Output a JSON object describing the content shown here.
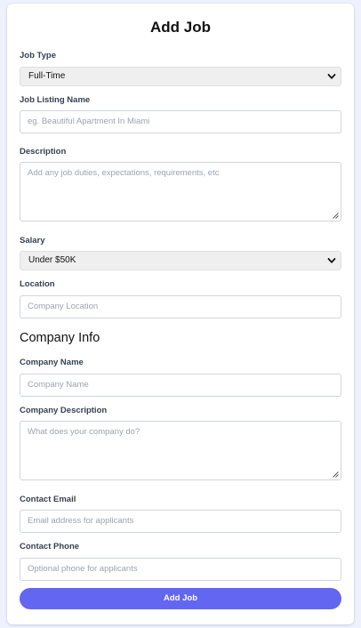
{
  "form": {
    "title": "Add Job",
    "job_type": {
      "label": "Job Type",
      "value": "Full-Time"
    },
    "listing_name": {
      "label": "Job Listing Name",
      "placeholder": "eg. Beautiful Apartment In Miami"
    },
    "description": {
      "label": "Description",
      "placeholder": "Add any job duties, expectations, requirements, etc"
    },
    "salary": {
      "label": "Salary",
      "value": "Under $50K"
    },
    "location": {
      "label": "Location",
      "placeholder": "Company Location"
    },
    "company_section": "Company Info",
    "company_name": {
      "label": "Company Name",
      "placeholder": "Company Name"
    },
    "company_description": {
      "label": "Company Description",
      "placeholder": "What does your company do?"
    },
    "contact_email": {
      "label": "Contact Email",
      "placeholder": "Email address for applicants"
    },
    "contact_phone": {
      "label": "Contact Phone",
      "placeholder": "Optional phone for applicants"
    },
    "submit_label": "Add Job"
  },
  "colors": {
    "background": "#eef2ff",
    "accent": "#6366f1"
  }
}
